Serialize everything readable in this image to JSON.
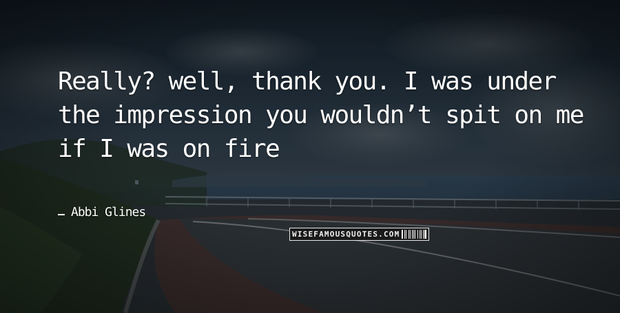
{
  "quote": {
    "text": "Really? well, thank you. I was under the impression you wouldn’t spit on me if I was on fire"
  },
  "author": {
    "name": "Abbi Glines"
  },
  "watermark": {
    "text": "WISEFAMOUSQUOTES.COM"
  },
  "colors": {
    "text": "#ffffff",
    "sky": "#1d2b36",
    "road": "#2f3538",
    "red_lane": "#5a3a36"
  }
}
